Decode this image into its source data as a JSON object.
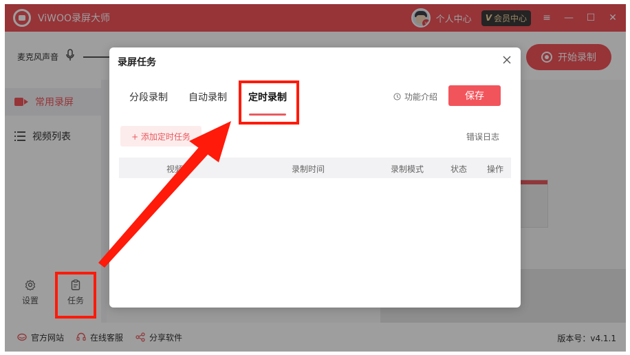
{
  "app": {
    "title": "ViWOO录屏大师",
    "user_center": "个人中心",
    "vip_mark": "V",
    "vip_label": "会员中心",
    "window_controls": [
      "≡",
      "—",
      "☐",
      "✕"
    ]
  },
  "toolbar": {
    "mic_label": "麦克风声音",
    "start_record_label": "开始录制"
  },
  "sidebar": {
    "items": [
      {
        "label": "常用录屏",
        "icon": "video-camera-icon",
        "active": true
      },
      {
        "label": "视频列表",
        "icon": "list-icon",
        "active": false
      }
    ],
    "bottom": [
      {
        "label": "设置",
        "icon": "gear-icon"
      },
      {
        "label": "任务",
        "icon": "clipboard-icon"
      }
    ]
  },
  "footer": {
    "links": [
      {
        "label": "官方网站",
        "icon": "globe-icon"
      },
      {
        "label": "在线客服",
        "icon": "headset-icon"
      },
      {
        "label": "分享软件",
        "icon": "share-icon"
      }
    ],
    "version": "版本号：v4.1.1"
  },
  "modal": {
    "title": "录屏任务",
    "tabs": [
      {
        "label": "分段录制",
        "active": false
      },
      {
        "label": "自动录制",
        "active": false
      },
      {
        "label": "定时录制",
        "active": true
      }
    ],
    "intro_label": "功能介绍",
    "save_label": "保存",
    "add_task_label": "+ 添加定时任务",
    "error_log_label": "错误日志",
    "columns": [
      "视频",
      "录制时间",
      "录制模式",
      "状态",
      "操作"
    ]
  },
  "colors": {
    "brand": "#f2545b",
    "annotation": "#ff1a0a"
  }
}
